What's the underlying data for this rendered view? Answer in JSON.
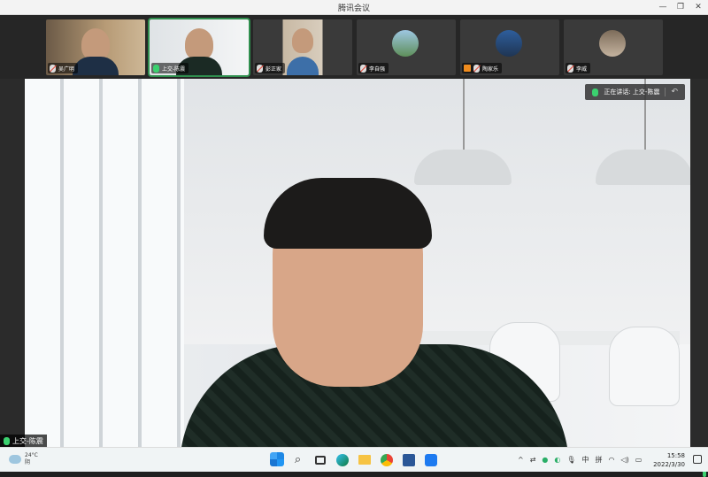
{
  "window": {
    "title": "腾讯会议"
  },
  "participants": [
    {
      "name": "吴广明",
      "mic": "muted",
      "kind": "video",
      "active": false
    },
    {
      "name": "上交-陈震",
      "mic": "on",
      "kind": "video",
      "active": true
    },
    {
      "name": "彭正家",
      "mic": "muted",
      "kind": "video",
      "active": false
    },
    {
      "name": "李自强",
      "mic": "muted",
      "kind": "avatar",
      "active": false
    },
    {
      "name": "陶家乐",
      "mic": "muted",
      "kind": "avatar",
      "active": false
    },
    {
      "name": "李威",
      "mic": "muted",
      "kind": "avatar",
      "active": false
    }
  ],
  "speaker_banner": {
    "text": "正在讲话: 上交-陈震"
  },
  "main_speaker": {
    "name": "上交-陈震"
  },
  "taskbar": {
    "weather_temp": "24°C",
    "weather_desc": "阴",
    "ime": "中",
    "ime2": "拼",
    "time": "15:58",
    "date": "2022/3/30"
  },
  "colors": {
    "active_outline": "#2f8f4e",
    "mic_on": "#3bd16f",
    "mute_red": "#e64a3b"
  }
}
